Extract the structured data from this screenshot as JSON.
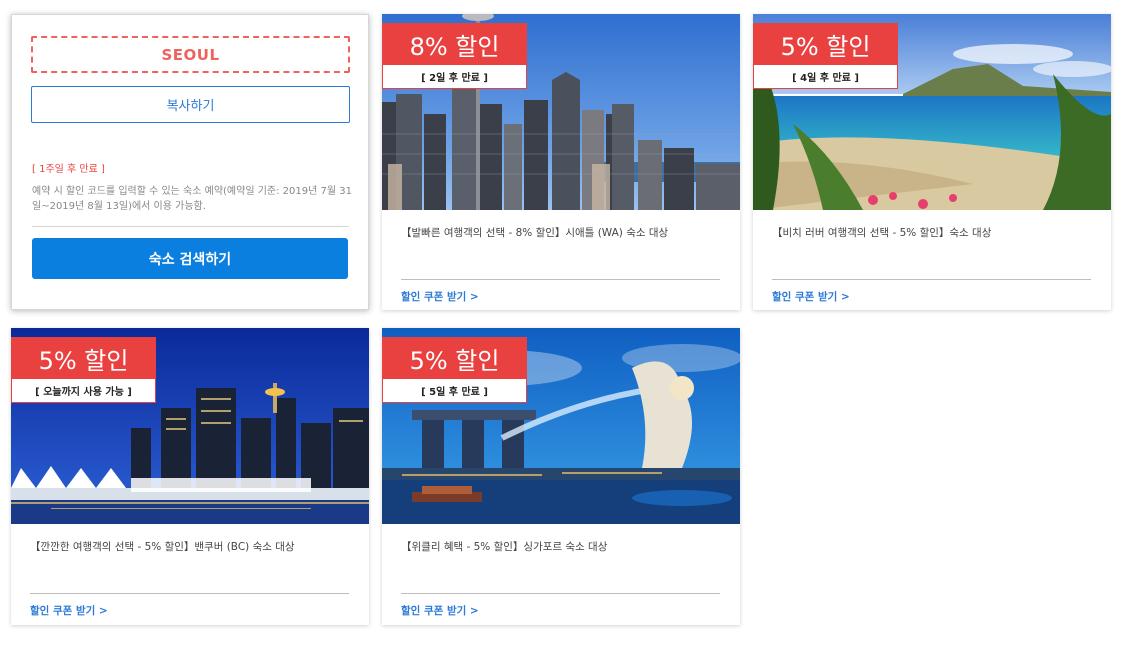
{
  "code_card": {
    "code": "SEOUL",
    "copy_label": "복사하기",
    "expiry": "[ 1주일 후 만료 ]",
    "description": "예약 시 할인 코드를 입력할 수 있는 숙소 예약(예약일 기준: 2019년 7월 31일~2019년 8월 13일)에서 이용 가능함.",
    "search_label": "숙소 검색하기"
  },
  "deals": [
    {
      "discount": "8% 할인",
      "expiry": "[ 2일 후 만료 ]",
      "title": "【발빠른 여행객의 선택 - 8% 할인】시애틀 (WA) 숙소 대상",
      "link": "할인 쿠폰 받기 >",
      "image": "seattle-skyline"
    },
    {
      "discount": "5% 할인",
      "expiry": "[ 4일 후 만료 ]",
      "title": "【비치 러버 여행객의 선택 - 5% 할인】숙소 대상",
      "link": "할인 쿠폰 받기 >",
      "image": "hawaii-beach"
    },
    {
      "discount": "5% 할인",
      "expiry": "[ 오늘까지 사용 가능 ]",
      "title": "【깐깐한 여행객의 선택 - 5% 할인】밴쿠버 (BC) 숙소 대상",
      "link": "할인 쿠폰 받기 >",
      "image": "vancouver-night"
    },
    {
      "discount": "5% 할인",
      "expiry": "[ 5일 후 만료 ]",
      "title": "【위클리 혜택 - 5% 할인】싱가포르 숙소 대상",
      "link": "할인 쿠폰 받기 >",
      "image": "singapore-merlion"
    }
  ],
  "colors": {
    "badge_red": "#e94040",
    "code_red": "#f0625c",
    "primary_blue": "#0a7fe0",
    "link_blue": "#2b7ad6"
  }
}
